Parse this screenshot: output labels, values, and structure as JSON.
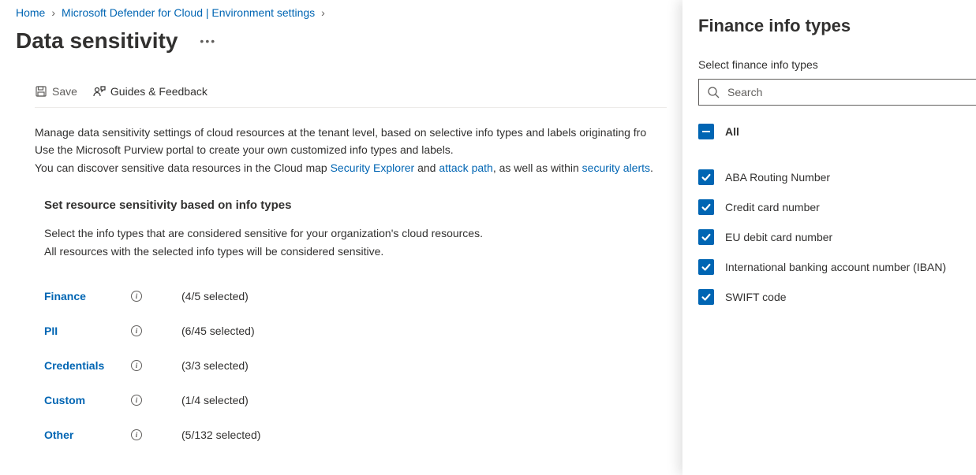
{
  "breadcrumb": {
    "home": "Home",
    "defender": "Microsoft Defender for Cloud | Environment settings"
  },
  "page": {
    "title": "Data sensitivity"
  },
  "toolbar": {
    "save": "Save",
    "guides": "Guides & Feedback"
  },
  "description": {
    "line1": "Manage data sensitivity settings of cloud resources at the tenant level, based on selective info types and labels originating fro",
    "purview_a": "Use the Microsoft Purview portal to create your own customized info types and labels.",
    "discover_pre": "You can discover sensitive data resources in the Cloud map ",
    "security_explorer": "Security Explorer",
    "discover_mid1": " and ",
    "attack_path": "attack path",
    "discover_mid2": ", as well as within ",
    "security_alerts": "security alerts",
    "discover_end": "."
  },
  "section": {
    "heading": "Set resource sensitivity based on info types",
    "desc1": "Select the info types that are considered sensitive for your organization's cloud resources.",
    "desc2": "All resources with the selected info types will be considered sensitive."
  },
  "info_types": [
    {
      "name": "Finance",
      "count": "(4/5 selected)"
    },
    {
      "name": "PII",
      "count": "(6/45 selected)"
    },
    {
      "name": "Credentials",
      "count": "(3/3 selected)"
    },
    {
      "name": "Custom",
      "count": "(1/4 selected)"
    },
    {
      "name": "Other",
      "count": "(5/132 selected)"
    }
  ],
  "side_panel": {
    "title": "Finance info types",
    "label": "Select finance info types",
    "search_placeholder": "Search",
    "all_label": "All",
    "items": [
      "ABA Routing Number",
      "Credit card number",
      "EU debit card number",
      "International banking account number (IBAN)",
      "SWIFT code"
    ]
  }
}
